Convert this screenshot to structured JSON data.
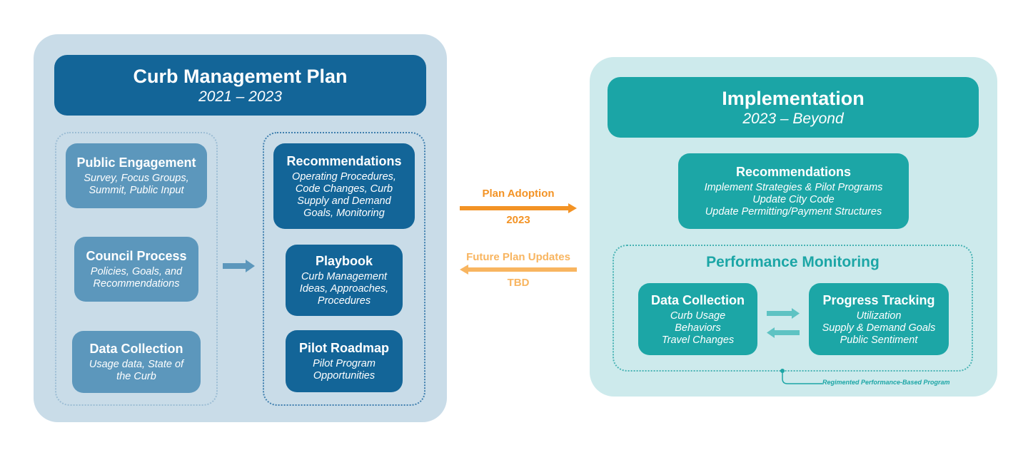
{
  "left_panel": {
    "title": "Curb Management Plan",
    "subtitle": "2021 – 2023",
    "inputs": [
      {
        "title": "Public Engagement",
        "desc": "Survey, Focus Groups,\nSummit, Public Input"
      },
      {
        "title": "Council Process",
        "desc": "Policies, Goals, and\nRecommendations"
      },
      {
        "title": "Data Collection",
        "desc": "Usage data, State of\nthe Curb"
      }
    ],
    "outputs": [
      {
        "title": "Recommendations",
        "desc": "Operating Procedures,\nCode Changes, Curb\nSupply and Demand\nGoals, Monitoring"
      },
      {
        "title": "Playbook",
        "desc": "Curb Management\nIdeas, Approaches,\nProcedures"
      },
      {
        "title": "Pilot Roadmap",
        "desc": "Pilot Program\nOpportunities"
      }
    ]
  },
  "transitions": {
    "forward": {
      "label": "Plan Adoption",
      "sub": "2023",
      "color": "#f39325"
    },
    "backward": {
      "label": "Future Plan Updates",
      "sub": "TBD",
      "color": "#f8b560"
    }
  },
  "right_panel": {
    "title": "Implementation",
    "subtitle": "2023 – Beyond",
    "recommendations": {
      "title": "Recommendations",
      "desc": "Implement Strategies & Pilot Programs\nUpdate City Code\nUpdate Permitting/Payment Structures"
    },
    "monitoring": {
      "title": "Performance Monitoring",
      "data_collection": {
        "title": "Data Collection",
        "desc": "Curb Usage\nBehaviors\nTravel Changes"
      },
      "progress_tracking": {
        "title": "Progress Tracking",
        "desc": "Utilization\nSupply & Demand Goals\nPublic Sentiment"
      },
      "callout": "Regimented Performance-Based Program"
    }
  },
  "colors": {
    "left_panel_bg": "#c9dce8",
    "right_panel_bg": "#cdeaec",
    "dark_blue": "#136598",
    "mid_blue": "#5c97bc",
    "teal": "#1ca6a6",
    "orange": "#f39325",
    "light_orange": "#f8b560"
  }
}
